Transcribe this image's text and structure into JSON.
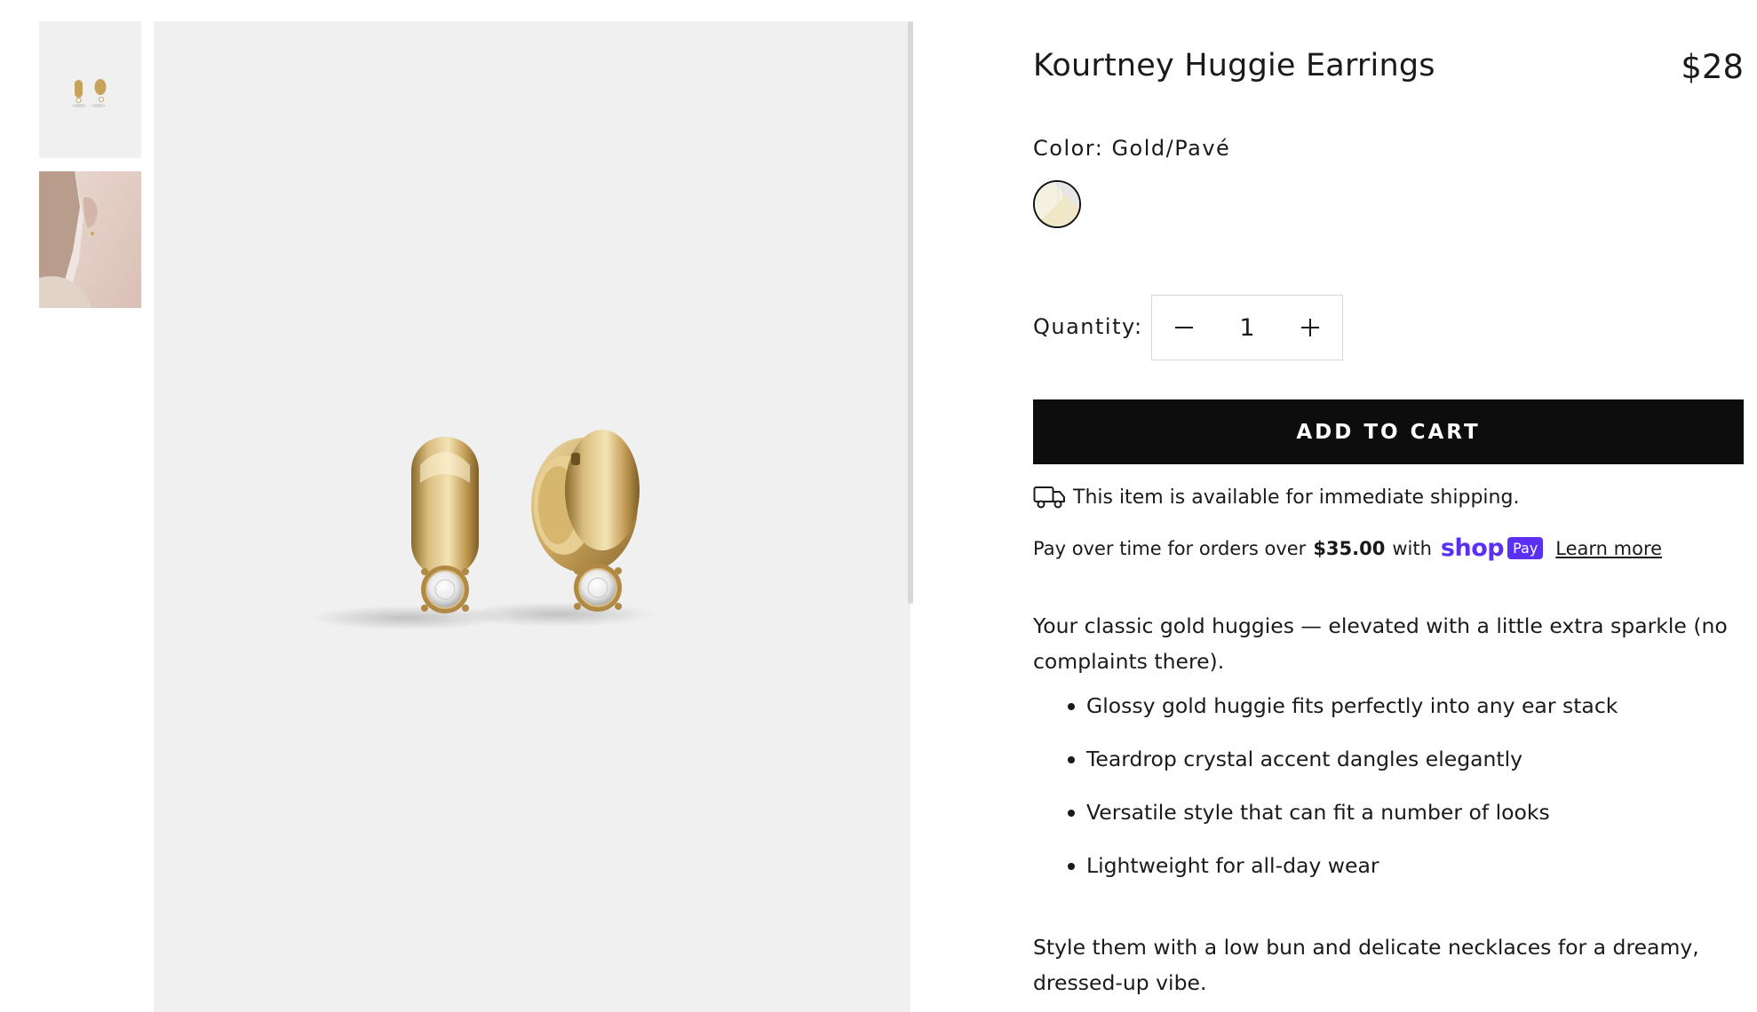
{
  "product": {
    "title": "Kourtney Huggie Earrings",
    "price": "$28"
  },
  "variant": {
    "color_label": "Color: Gold/Pavé",
    "swatch_name": "Gold/Pavé"
  },
  "quantity": {
    "label": "Quantity:",
    "value": "1",
    "decrease_icon": "minus-icon",
    "increase_icon": "plus-icon"
  },
  "cart": {
    "add_to_cart_label": "ADD TO CART"
  },
  "shipping": {
    "icon": "truck-icon",
    "text": "This item is available for immediate shipping."
  },
  "payment": {
    "prefix": "Pay over time for orders over",
    "amount": "$35.00",
    "suffix": "with",
    "shop_wordmark": "shop",
    "pay_badge": "Pay",
    "learn_more": "Learn more",
    "brand_color": "#5a31f4"
  },
  "description": {
    "intro": "Your classic gold huggies — elevated with a little extra sparkle (no complaints there).",
    "features": [
      "Glossy gold huggie fits perfectly into any ear stack",
      "Teardrop crystal accent dangles elegantly",
      "Versatile style that can fit a number of looks",
      "Lightweight for all-day wear"
    ],
    "styling_note": "Style them with a low bun and delicate necklaces for a dreamy, dressed-up vibe."
  },
  "gallery": {
    "thumbnails": [
      "earrings-product-thumbnail",
      "model-wearing-earrings-thumbnail"
    ],
    "background_color": "#f0f0f0",
    "accent_gold": "#c9a45c"
  }
}
